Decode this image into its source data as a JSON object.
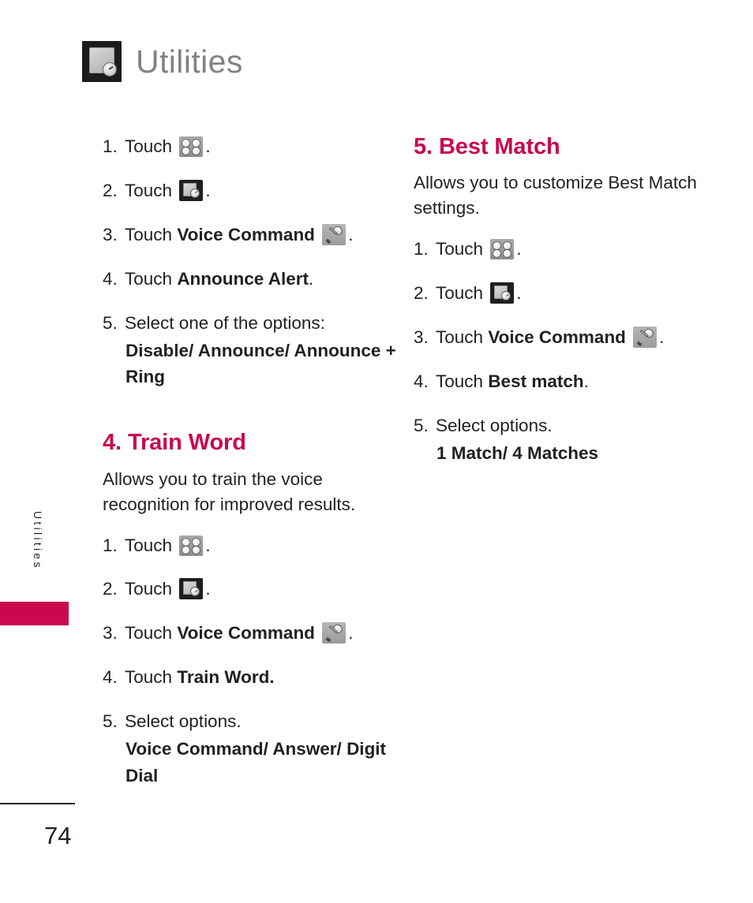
{
  "header": {
    "title": "Utilities",
    "icon": "utilities-clock-icon"
  },
  "side_tab": {
    "label": "Utilities",
    "accent_color": "#c9084e"
  },
  "footer": {
    "page_number": "74"
  },
  "colors": {
    "accent": "#c9084e",
    "header_title": "#828282",
    "body_text": "#231f20"
  },
  "left_column": {
    "top_steps": [
      {
        "num": "1.",
        "text": "Touch",
        "icon": "grid-menu-icon",
        "suffix": "."
      },
      {
        "num": "2.",
        "text": "Touch",
        "icon": "utilities-icon",
        "suffix": "."
      },
      {
        "num": "3.",
        "text": "Touch",
        "bold": "Voice Command",
        "icon": "microphone-icon",
        "suffix": "."
      },
      {
        "num": "4.",
        "text": "Touch",
        "bold": "Announce Alert",
        "suffix": "."
      },
      {
        "num": "5.",
        "text": "Select one of the options:",
        "options": "Disable/ Announce/\nAnnounce + Ring"
      }
    ],
    "section": {
      "title": "4. Train Word",
      "intro": "Allows you to train the voice recognition for improved results.",
      "steps": [
        {
          "num": "1.",
          "text": "Touch",
          "icon": "grid-menu-icon",
          "suffix": "."
        },
        {
          "num": "2.",
          "text": "Touch",
          "icon": "utilities-icon",
          "suffix": "."
        },
        {
          "num": "3.",
          "text": "Touch",
          "bold": "Voice Command",
          "icon": "microphone-icon",
          "suffix": "."
        },
        {
          "num": "4.",
          "text": "Touch",
          "bold": "Train Word.",
          "suffix": ""
        },
        {
          "num": "5.",
          "text": "Select options.",
          "options": "Voice Command/ Answer/\nDigit Dial"
        }
      ]
    }
  },
  "right_column": {
    "section": {
      "title": "5. Best Match",
      "intro": "Allows you to customize Best Match settings.",
      "steps": [
        {
          "num": "1.",
          "text": "Touch",
          "icon": "grid-menu-icon",
          "suffix": "."
        },
        {
          "num": "2.",
          "text": "Touch",
          "icon": "utilities-icon",
          "suffix": "."
        },
        {
          "num": "3.",
          "text": "Touch",
          "bold": "Voice Command",
          "icon": "microphone-icon",
          "suffix": "."
        },
        {
          "num": "4.",
          "text": "Touch",
          "bold": "Best match",
          "suffix": "."
        },
        {
          "num": "5.",
          "text": "Select options.",
          "options": "1 Match/ 4 Matches"
        }
      ]
    }
  }
}
